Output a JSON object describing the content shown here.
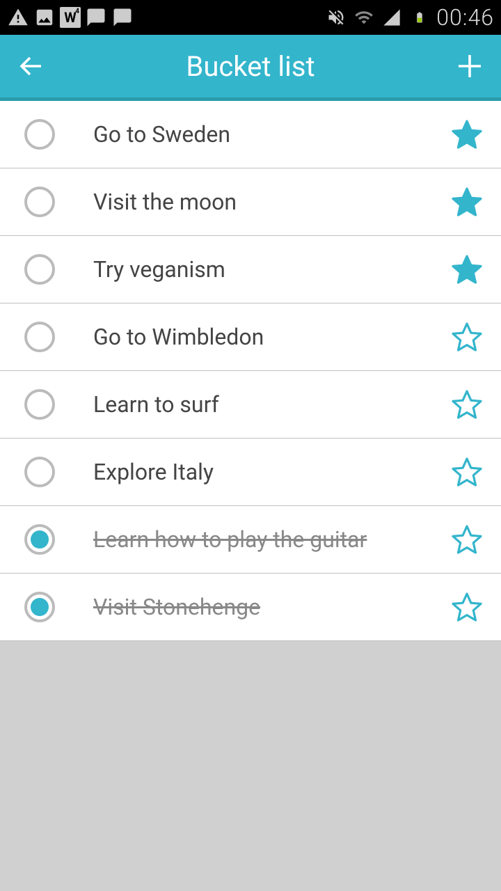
{
  "status": {
    "time": "00:46"
  },
  "header": {
    "title": "Bucket list"
  },
  "colors": {
    "accent": "#33b5cc"
  },
  "items": [
    {
      "label": "Go to Sweden",
      "done": false,
      "starred": true
    },
    {
      "label": "Visit the moon",
      "done": false,
      "starred": true
    },
    {
      "label": "Try veganism",
      "done": false,
      "starred": true
    },
    {
      "label": "Go to Wimbledon",
      "done": false,
      "starred": false
    },
    {
      "label": "Learn to surf",
      "done": false,
      "starred": false
    },
    {
      "label": "Explore Italy",
      "done": false,
      "starred": false
    },
    {
      "label": "Learn how to play the guitar",
      "done": true,
      "starred": false
    },
    {
      "label": "Visit Stonehenge",
      "done": true,
      "starred": false
    }
  ]
}
